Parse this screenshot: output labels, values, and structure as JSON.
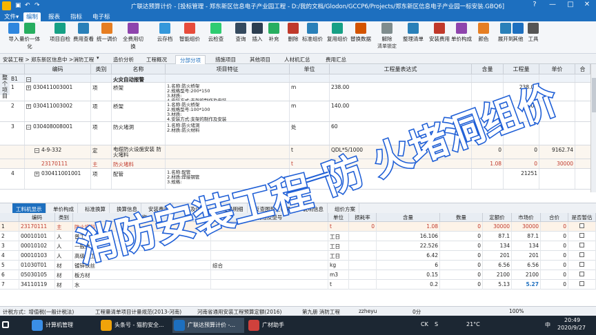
{
  "window": {
    "title": "广联达预算计价 - [投标管理 - 郑东新区信息电子产业园工程 - D:/我的文档/Glodon/GCCP6/Projects/郑东新区信息电子产业园一标安装.GBQ6]",
    "controls": [
      "?",
      "—",
      "□",
      "✕"
    ]
  },
  "menu": [
    "文件▾",
    "编制",
    "报表",
    "指标",
    "电子标"
  ],
  "menu_active": 1,
  "ribbon": [
    {
      "label": "导入",
      "icon": "import-icon",
      "color": "#2e86de"
    },
    {
      "label": "量价一体化",
      "icon": "integrate-icon",
      "color": "#27ae60"
    },
    {
      "label": "项目自检",
      "icon": "check-icon",
      "color": "#16a085"
    },
    {
      "label": "费用查看",
      "icon": "view-icon",
      "color": "#2980b9"
    },
    {
      "label": "统一调价",
      "icon": "price-icon",
      "color": "#e67e22"
    },
    {
      "label": "全费用切换",
      "icon": "switch-icon",
      "color": "#8e44ad"
    },
    {
      "label": "云存档",
      "icon": "cloud-icon",
      "color": "#3498db"
    },
    {
      "label": "智能组价",
      "icon": "smart-icon",
      "color": "#e74c3c"
    },
    {
      "label": "云检查",
      "icon": "cloud-check-icon",
      "color": "#2ecc71"
    },
    {
      "label": "查询",
      "icon": "search-icon",
      "color": "#34495e"
    },
    {
      "label": "插入",
      "icon": "insert-icon",
      "color": "#2c3e50"
    },
    {
      "label": "补充",
      "icon": "add-icon",
      "color": "#27ae60"
    },
    {
      "label": "删除",
      "icon": "delete-icon",
      "color": "#c0392b"
    },
    {
      "label": "标准组价",
      "icon": "standard-icon",
      "color": "#2980b9"
    },
    {
      "label": "复用组价",
      "icon": "reuse-icon",
      "color": "#16a085"
    },
    {
      "label": "替换数据",
      "icon": "replace-icon",
      "color": "#d35400"
    },
    {
      "label": "解除",
      "icon": "unlock-icon",
      "color": "#7f8c8d",
      "sub": "清单锁定"
    },
    {
      "label": "整理清单",
      "icon": "organize-icon",
      "color": "#2980b9"
    },
    {
      "label": "安装费用",
      "icon": "install-icon",
      "color": "#c0392b"
    },
    {
      "label": "单价构成",
      "icon": "price-comp-icon",
      "color": "#8e44ad"
    },
    {
      "label": "颜色",
      "icon": "color-icon",
      "color": "#e67e22"
    },
    {
      "label": "展开到",
      "icon": "expand-icon",
      "color": "#2980b9"
    },
    {
      "label": "其他",
      "icon": "other-icon",
      "color": "#1d6fbf"
    },
    {
      "label": "工具",
      "icon": "tool-icon",
      "color": "#555555"
    }
  ],
  "project": {
    "label": "安装工程 > 郑东新区信息中 >消防工程",
    "dropdown": "▾"
  },
  "top_tabs": [
    "造价分析",
    "工程概况",
    "分部分项",
    "措施项目",
    "其他项目",
    "人材机汇总",
    "费用汇总"
  ],
  "top_tab_active": 2,
  "side_label": "整个项目",
  "grid": {
    "headers": [
      "编码",
      "类别",
      "名称",
      "项目特征",
      "单位",
      "工程量表达式",
      "含量",
      "工程量",
      "单价",
      "合"
    ],
    "rows": [
      {
        "no": "B1",
        "toggle": "−",
        "code": "",
        "cat": "",
        "name": "火灾自动报警",
        "feature": "",
        "unit": "",
        "expr": "",
        "content": "",
        "qty": "",
        "price": "",
        "bold": true
      },
      {
        "no": "1",
        "toggle": "+",
        "code": "030411003001",
        "cat": "项",
        "name": "桥架",
        "feature": "1.名称:防火桥架\n2.规格型号:200*150\n3.材质:\n4.安装方式:支架的制作及安装",
        "unit": "m",
        "expr": "238.00",
        "content": "",
        "qty": "238.00",
        "price": ""
      },
      {
        "no": "2",
        "toggle": "+",
        "code": "030411003002",
        "cat": "项",
        "name": "桥架",
        "feature": "1.名称:防火桥架\n2.规格型号:100*100\n3.材质:\n4.安装方式:支架的制作及安装",
        "unit": "m",
        "expr": "140.00",
        "content": "",
        "qty": "140.00",
        "price": ""
      },
      {
        "no": "3",
        "toggle": "−",
        "code": "030408008001",
        "cat": "项",
        "name": "防火堵洞",
        "feature": "1.名称:防火堵洞\n2.材质:防火材料",
        "unit": "处",
        "expr": "60",
        "content": "",
        "qty": "",
        "price": ""
      },
      {
        "no": "",
        "toggle": "−",
        "code": "4-9-332",
        "cat": "定",
        "name": "电缆防火设施安装 防火堵料",
        "feature": "",
        "unit": "t",
        "expr": "QDL*5/1000",
        "content": "0",
        "qty": "0",
        "price": "9162.74"
      },
      {
        "no": "",
        "toggle": "",
        "code": "23170111",
        "cat": "主",
        "name": "防火堵料",
        "feature": "",
        "unit": "t",
        "expr": "",
        "content": "1.08",
        "qty": "0",
        "price": "30000",
        "red": true
      },
      {
        "no": "4",
        "toggle": "+",
        "code": "030411001001",
        "cat": "项",
        "name": "配管",
        "feature": "1.名称:配管\n2.材质:焊接钢管\n3.规格:",
        "unit": "",
        "expr": "",
        "content": "",
        "qty": "21251",
        "price": ""
      }
    ]
  },
  "bottom_tabs": [
    "工料机显示",
    "单价构成",
    "标准换算",
    "换算信息",
    "安装费用",
    "特征及内容",
    "工程量明细",
    "反查图形工程量",
    "说明信息",
    "组价方案"
  ],
  "bottom_tab_active": 0,
  "grid2": {
    "headers": [
      "编码",
      "类别",
      "名称",
      "规格及型号",
      "单位",
      "损耗率",
      "含量",
      "数量",
      "定额价",
      "市场价",
      "合价",
      "是否暂估"
    ],
    "rows": [
      {
        "no": "1",
        "code": "23170111",
        "cat": "主",
        "name": "防火堵料",
        "spec": "",
        "unit": "t",
        "loss": "0",
        "content": "1.08",
        "count": "0",
        "quota": "30000",
        "market": "30000",
        "total": "0",
        "red": true
      },
      {
        "no": "2",
        "code": "00010101",
        "cat": "人",
        "name": "普工",
        "spec": "",
        "unit": "工日",
        "loss": "",
        "content": "16.106",
        "count": "0",
        "quota": "87.1",
        "market": "87.1",
        "total": "0"
      },
      {
        "no": "3",
        "code": "00010102",
        "cat": "人",
        "name": "一般技工",
        "spec": "",
        "unit": "工日",
        "loss": "",
        "content": "22.526",
        "count": "0",
        "quota": "134",
        "market": "134",
        "total": "0"
      },
      {
        "no": "4",
        "code": "00010103",
        "cat": "人",
        "name": "高级技工",
        "spec": "",
        "unit": "工日",
        "loss": "",
        "content": "6.42",
        "count": "0",
        "quota": "201",
        "market": "201",
        "total": "0"
      },
      {
        "no": "5",
        "code": "01030T01",
        "cat": "材",
        "name": "镀锌铁丝",
        "spec": "综合",
        "unit": "kg",
        "loss": "",
        "content": "6",
        "count": "0",
        "quota": "6.56",
        "market": "6.56",
        "total": "0"
      },
      {
        "no": "6",
        "code": "05030105",
        "cat": "材",
        "name": "板方材",
        "spec": "",
        "unit": "m3",
        "loss": "",
        "content": "0.15",
        "count": "0",
        "quota": "2100",
        "market": "2100",
        "total": "0"
      },
      {
        "no": "7",
        "code": "34110119",
        "cat": "材",
        "name": "水",
        "spec": "",
        "unit": "t",
        "loss": "",
        "content": "0.2",
        "count": "0",
        "quota": "5.13",
        "market": "5.27",
        "total": "0"
      }
    ]
  },
  "status": [
    "计税方式：增值税(一般计税法)",
    "工程量清单项目计量规范(2013-河南)",
    "河南省通用安装工程预算定额(2016)",
    "第九册 消防工程",
    "zzheyu",
    "0分",
    "100%"
  ],
  "taskbar": {
    "items": [
      {
        "label": "计算机管理",
        "color": "#3a8ee6"
      },
      {
        "label": "头条号 - 猫豹安全...",
        "color": "#f0a30a"
      },
      {
        "label": "广联达预算计价 -...",
        "color": "#1d6fbf"
      },
      {
        "label": "广材助手",
        "color": "#d0413c"
      }
    ],
    "tray": [
      "CK",
      "S",
      "21°C",
      "中"
    ],
    "time": "20:49",
    "date": "2020/9/27"
  },
  "overlay": {
    "line1": "消防安装工程",
    "line2": "防 火堵洞组价"
  }
}
